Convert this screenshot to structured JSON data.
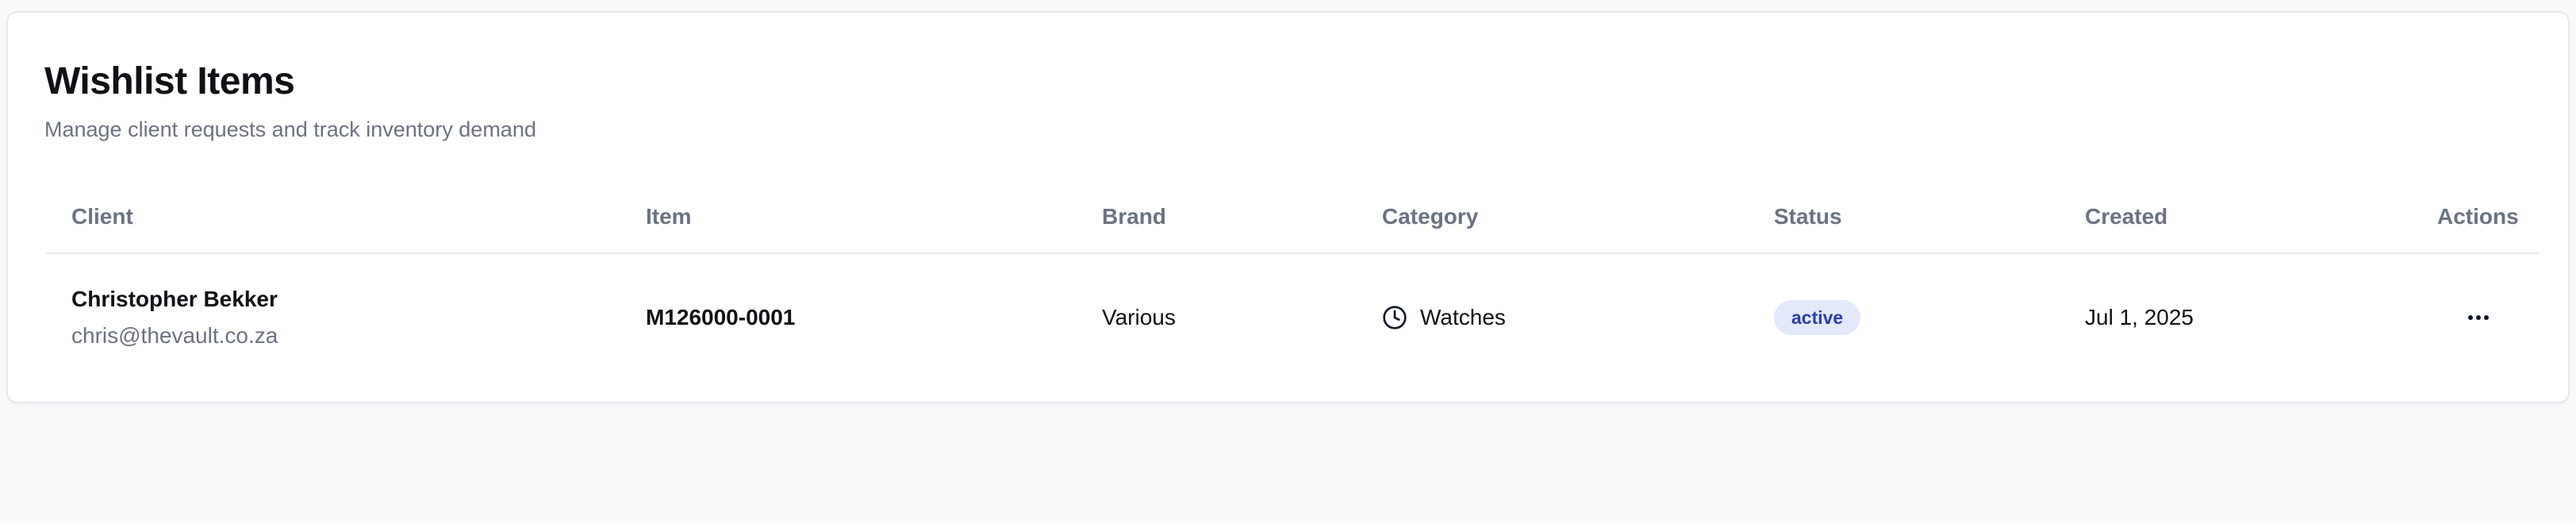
{
  "wishlist": {
    "title": "Wishlist Items",
    "subtitle": "Manage client requests and track inventory demand",
    "columns": {
      "client": "Client",
      "item": "Item",
      "brand": "Brand",
      "category": "Category",
      "status": "Status",
      "created": "Created",
      "actions": "Actions"
    },
    "rows": [
      {
        "client_name": "Christopher Bekker",
        "client_email": "chris@thevault.co.za",
        "item": "M126000-0001",
        "brand": "Various",
        "category": "Watches",
        "category_icon": "clock-icon",
        "status": "active",
        "created": "Jul 1, 2025",
        "actions_icon": "more-horizontal-icon"
      }
    ]
  },
  "colors": {
    "page_background": "#f8f9fb",
    "status_active_bg": "#e3e8fb",
    "status_active_text": "#2b3ea6",
    "muted_text": "#6b7280"
  }
}
